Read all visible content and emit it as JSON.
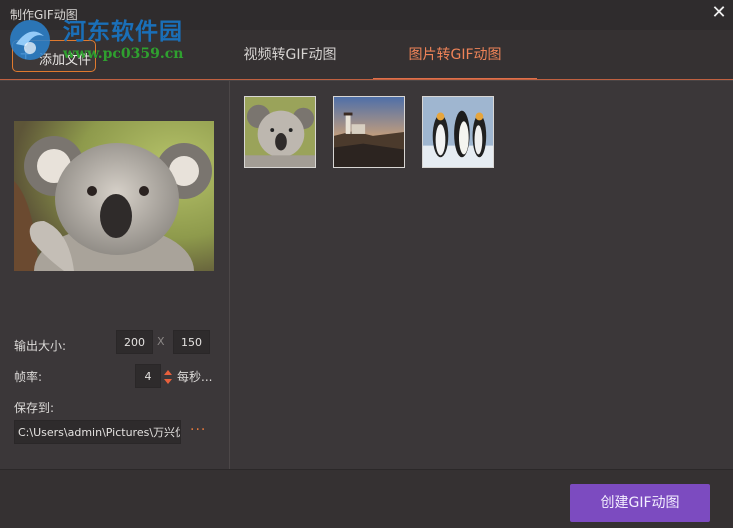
{
  "window": {
    "title": "制作GIF动图",
    "close_icon": "close-icon"
  },
  "watermark": {
    "name": "河东软件园",
    "url": "www.pc0359.cn"
  },
  "toolbar": {
    "add_label": "添加文件",
    "add_icon": "plus-icon"
  },
  "tabs": [
    {
      "label": "视频转GIF动图",
      "active": false
    },
    {
      "label": "图片转GIF动图",
      "active": true
    }
  ],
  "settings": {
    "output_size_label": "输出大小:",
    "width": "200",
    "separator": "X",
    "height": "150",
    "frame_rate_label": "帧率:",
    "frame_rate": "4",
    "frame_rate_unit": "每秒...",
    "save_to_label": "保存到:",
    "save_path": "C:\\Users\\admin\\Pictures\\万兴优",
    "browse": "···"
  },
  "thumbnails": [
    {
      "name": "koala",
      "icon": "koala-image"
    },
    {
      "name": "lighthouse",
      "icon": "lighthouse-image"
    },
    {
      "name": "penguins",
      "icon": "penguins-image"
    }
  ],
  "footer": {
    "create_label": "创建GIF动图"
  },
  "colors": {
    "accent_orange": "#e0704a",
    "create_purple": "#7c4bc0",
    "background": "#3b3739"
  }
}
